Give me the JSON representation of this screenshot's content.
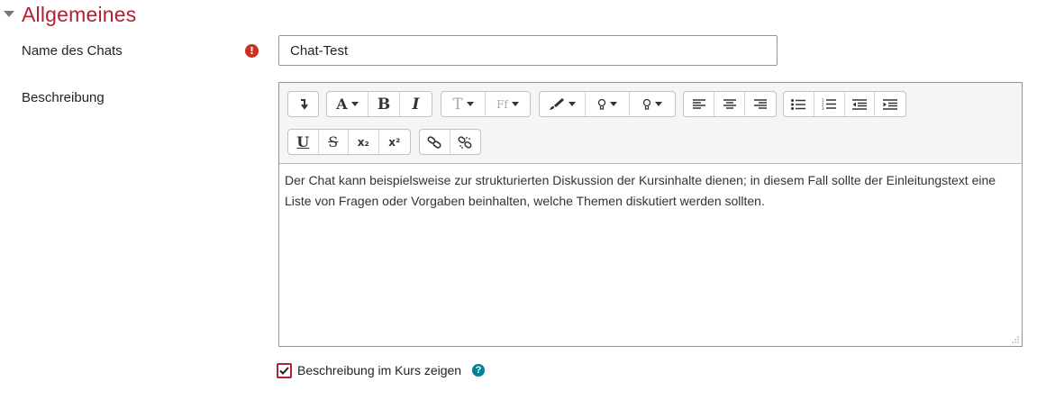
{
  "section": {
    "title": "Allgemeines"
  },
  "name_field": {
    "label": "Name des Chats",
    "value": "Chat-Test"
  },
  "description": {
    "label": "Beschreibung",
    "text": "Der Chat kann beispielsweise zur strukturierten Diskussion der Kursinhalte dienen; in diesem Fall sollte der Einleitungstext eine Liste von Fragen oder Vorgaben beinhalten, welche Themen diskutiert werden sollten."
  },
  "toolbar": {
    "font_label": "A",
    "bold_label": "B",
    "italic_label": "I",
    "size_label": "T",
    "family_label": "Ff",
    "underline_label": "U",
    "strike_label": "S",
    "subscript_label": "x₂",
    "superscript_label": "x²"
  },
  "show_description": {
    "label": "Beschreibung im Kurs zeigen",
    "checked": true
  },
  "colors": {
    "accent": "#b02132",
    "required": "#ca3120",
    "help": "#008196"
  }
}
